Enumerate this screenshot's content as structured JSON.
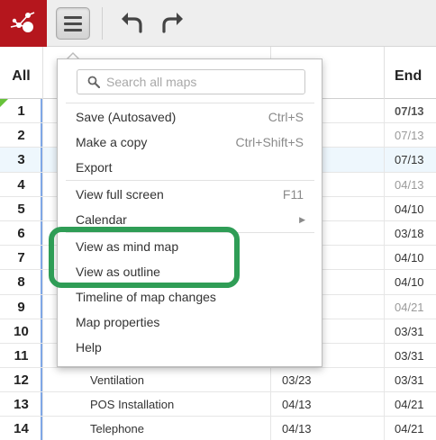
{
  "toolbar": {
    "logo_icon": "app-logo-icon",
    "menu_icon": "hamburger-icon",
    "undo_icon": "undo-icon",
    "redo_icon": "redo-icon",
    "brand_color": "#b5161d"
  },
  "grid": {
    "header_all": "All",
    "header_end": "End",
    "rows": [
      {
        "num": "1",
        "task": "",
        "start": "",
        "end": "07/13",
        "end_style": "bold"
      },
      {
        "num": "2",
        "task": "",
        "start": "",
        "end": "07/13",
        "end_style": "gray"
      },
      {
        "num": "3",
        "task": "",
        "start": "",
        "end": "07/13",
        "end_style": "dark"
      },
      {
        "num": "4",
        "task": "",
        "start": "",
        "end": "04/13",
        "end_style": "gray"
      },
      {
        "num": "5",
        "task": "",
        "start": "",
        "end": "04/10",
        "end_style": "dark"
      },
      {
        "num": "6",
        "task": "",
        "start": "",
        "end": "03/18",
        "end_style": "dark"
      },
      {
        "num": "7",
        "task": "",
        "start": "",
        "end": "04/10",
        "end_style": "dark"
      },
      {
        "num": "8",
        "task": "",
        "start": "",
        "end": "04/10",
        "end_style": "dark"
      },
      {
        "num": "9",
        "task": "",
        "start": "",
        "end": "04/21",
        "end_style": "gray"
      },
      {
        "num": "10",
        "task": "",
        "start": "",
        "end": "03/31",
        "end_style": "dark"
      },
      {
        "num": "11",
        "task": "",
        "start": "",
        "end": "03/31",
        "end_style": "dark"
      },
      {
        "num": "12",
        "task": "Ventilation",
        "start": "03/23",
        "end": "03/31",
        "end_style": "dark"
      },
      {
        "num": "13",
        "task": "POS Installation",
        "start": "04/13",
        "end": "04/21",
        "end_style": "dark"
      },
      {
        "num": "14",
        "task": "Telephone",
        "start": "04/13",
        "end": "04/21",
        "end_style": "dark"
      }
    ]
  },
  "menu": {
    "search_placeholder": "Search all maps",
    "items": [
      {
        "label": "Save (Autosaved)",
        "shortcut": "Ctrl+S"
      },
      {
        "label": "Make a copy",
        "shortcut": "Ctrl+Shift+S"
      },
      {
        "label": "Export",
        "shortcut": ""
      },
      {
        "label": "View full screen",
        "shortcut": "F11"
      },
      {
        "label": "Calendar",
        "shortcut": ""
      },
      {
        "label": "View as mind map",
        "shortcut": ""
      },
      {
        "label": "View as outline",
        "shortcut": ""
      },
      {
        "label": "Timeline of map changes",
        "shortcut": ""
      },
      {
        "label": "Map properties",
        "shortcut": ""
      },
      {
        "label": "Help",
        "shortcut": ""
      }
    ]
  },
  "highlight_color": "#2f9d56"
}
